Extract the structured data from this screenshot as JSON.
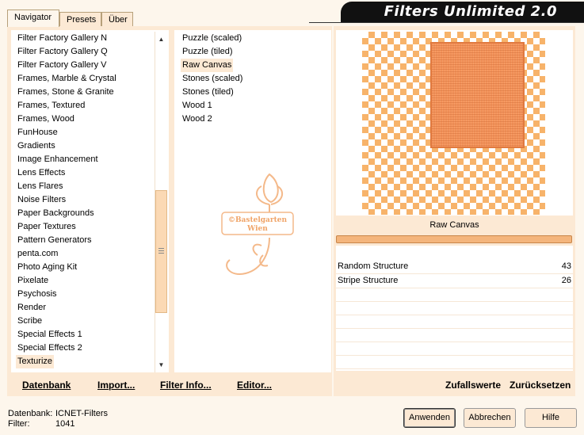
{
  "app": {
    "title": "Filters Unlimited 2.0"
  },
  "tabs": [
    {
      "label": "Navigator",
      "active": true
    },
    {
      "label": "Presets",
      "active": false
    },
    {
      "label": "Über",
      "active": false
    }
  ],
  "categories": [
    "Filter Factory Gallery N",
    "Filter Factory Gallery Q",
    "Filter Factory Gallery V",
    "Frames, Marble & Crystal",
    "Frames, Stone & Granite",
    "Frames, Textured",
    "Frames, Wood",
    "FunHouse",
    "Gradients",
    "Image Enhancement",
    "Lens Effects",
    "Lens Flares",
    "Noise Filters",
    "Paper Backgrounds",
    "Paper Textures",
    "Pattern Generators",
    "penta.com",
    "Photo Aging Kit",
    "Pixelate",
    "Psychosis",
    "Render",
    "Scribe",
    "Special Effects 1",
    "Special Effects 2",
    "Texturize"
  ],
  "selected_category": "Texturize",
  "filters": [
    "Puzzle (scaled)",
    "Puzzle (tiled)",
    "Raw Canvas",
    "Stones (scaled)",
    "Stones (tiled)",
    "Wood 1",
    "Wood 2"
  ],
  "selected_filter": "Raw Canvas",
  "preview": {
    "filter_name": "Raw Canvas",
    "params": [
      {
        "name": "Random Structure",
        "value": "43"
      },
      {
        "name": "Stripe Structure",
        "value": "26"
      }
    ]
  },
  "watermark": {
    "line1": "©Bastelgarten",
    "line2": "Wien"
  },
  "bottom_links": {
    "database": "Datenbank",
    "import": "Import...",
    "filter_info": "Filter Info...",
    "editor": "Editor...",
    "randomize": "Zufallswerte",
    "reset": "Zurücksetzen"
  },
  "status": {
    "database_label": "Datenbank:",
    "database_value": "ICNET-Filters",
    "filter_label": "Filter:",
    "filter_value": "1041"
  },
  "buttons": {
    "apply": "Anwenden",
    "cancel": "Abbrechen",
    "help": "Hilfe"
  },
  "colors": {
    "accent": "#f7b36a",
    "panel_bg": "#fce9d4",
    "title_bg": "#111111"
  }
}
